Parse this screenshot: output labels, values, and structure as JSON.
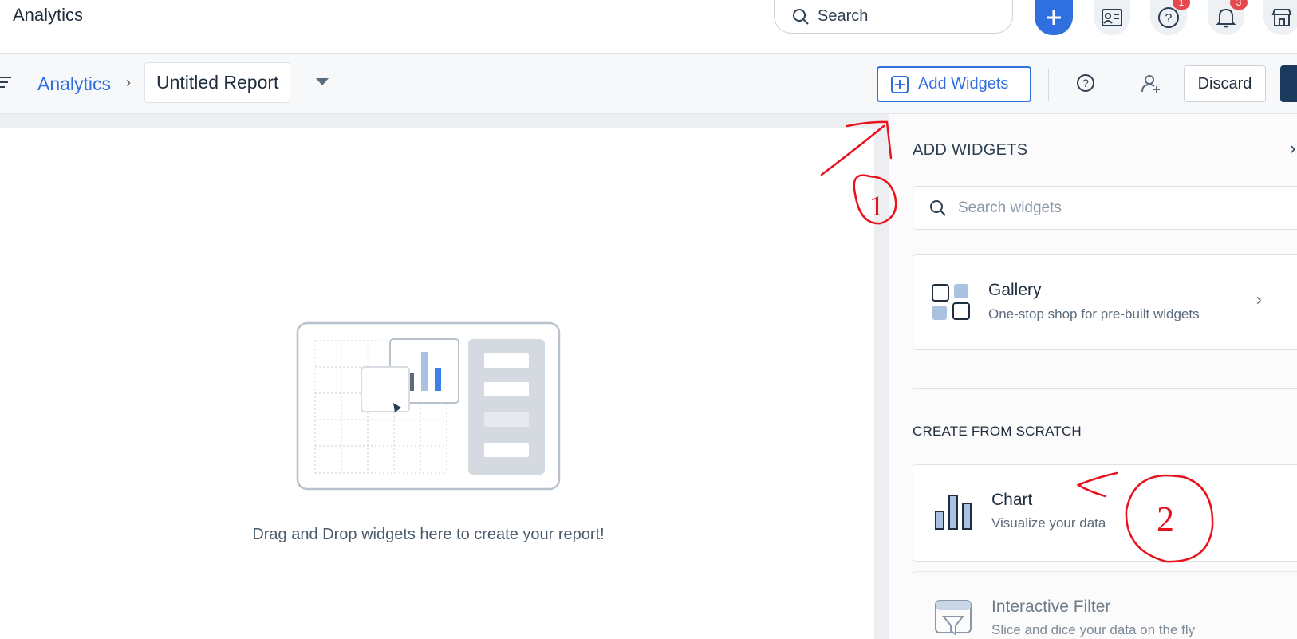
{
  "header": {
    "app_title": "Analytics",
    "search_label": "Search",
    "help_badge": "1",
    "notifications_badge": "3"
  },
  "toolbar": {
    "breadcrumb_root": "Analytics",
    "breadcrumb_separator": "›",
    "report_name": "Untitled Report",
    "add_widgets_label": "Add Widgets",
    "discard_label": "Discard"
  },
  "canvas": {
    "empty_message": "Drag and Drop widgets here to create your report!"
  },
  "panel": {
    "title": "ADD WIDGETS",
    "search_placeholder": "Search widgets",
    "gallery": {
      "title": "Gallery",
      "subtitle": "One-stop shop for pre-built widgets"
    },
    "section_label": "CREATE FROM SCRATCH",
    "chart": {
      "title": "Chart",
      "subtitle": "Visualize your data"
    },
    "filter": {
      "title": "Interactive Filter",
      "subtitle": "Slice and dice your data on the fly"
    }
  },
  "annotations": {
    "step1": "1",
    "step2": "2"
  },
  "colors": {
    "accent": "#2f6fe0",
    "annotation": "#e8121c",
    "badge": "#e5484d",
    "primary_dark": "#1c3a5e"
  },
  "icons": {
    "search": "search-icon",
    "plus": "plus-icon",
    "contacts": "contact-card-icon",
    "help": "help-icon",
    "bell": "bell-icon",
    "marketplace": "store-icon",
    "menu": "menu-icon",
    "add_widget": "add-square-icon",
    "add_user": "add-user-icon",
    "gallery": "gallery-grid-icon",
    "chevron": "chevron-right-icon",
    "chart": "bar-chart-icon",
    "filter": "filter-icon"
  }
}
